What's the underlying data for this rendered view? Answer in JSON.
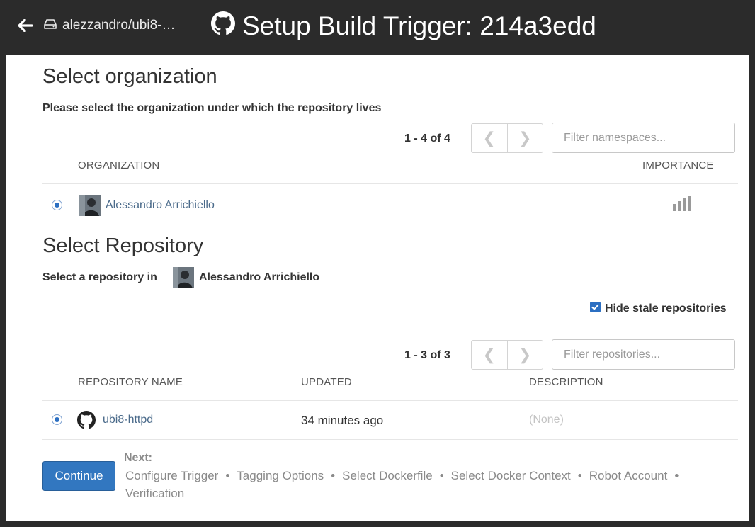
{
  "header": {
    "repo_crumb": "alezzandro/ubi8-…",
    "title": "Setup Build Trigger: 214a3edd"
  },
  "organization_section": {
    "heading": "Select organization",
    "description": "Please select the organization under which the repository lives",
    "pagination": "1 - 4 of 4",
    "filter_placeholder": "Filter namespaces...",
    "columns": [
      "ORGANIZATION",
      "IMPORTANCE"
    ],
    "rows": [
      {
        "name": "Alessandro Arrichiello",
        "selected": true,
        "importance_bars": 4
      }
    ]
  },
  "repository_section": {
    "heading": "Select Repository",
    "description_prefix": "Select a repository in",
    "organization_name": "Alessandro Arrichiello",
    "hide_stale_label": "Hide stale repositories",
    "hide_stale_checked": true,
    "pagination": "1 - 3 of 3",
    "filter_placeholder": "Filter repositories...",
    "columns": [
      "REPOSITORY NAME",
      "UPDATED",
      "DESCRIPTION"
    ],
    "rows": [
      {
        "name": "ubi8-httpd",
        "updated": "34 minutes ago",
        "description": "(None)",
        "selected": true
      }
    ]
  },
  "footer": {
    "continue_label": "Continue",
    "next_label": "Next:",
    "steps": [
      "Configure Trigger",
      "Tagging Options",
      "Select Dockerfile",
      "Select Docker Context",
      "Robot Account",
      "Verification"
    ]
  },
  "icons": {
    "back": "arrow-left-icon",
    "repo": "hdd-icon",
    "github": "github-icon",
    "prev": "chevron-left-icon",
    "next": "chevron-right-icon",
    "importance": "signal-bars-icon",
    "check": "check-icon"
  },
  "colors": {
    "header_bg": "#2b2b2b",
    "primary": "#3277c0",
    "link": "#4a6a8a"
  }
}
